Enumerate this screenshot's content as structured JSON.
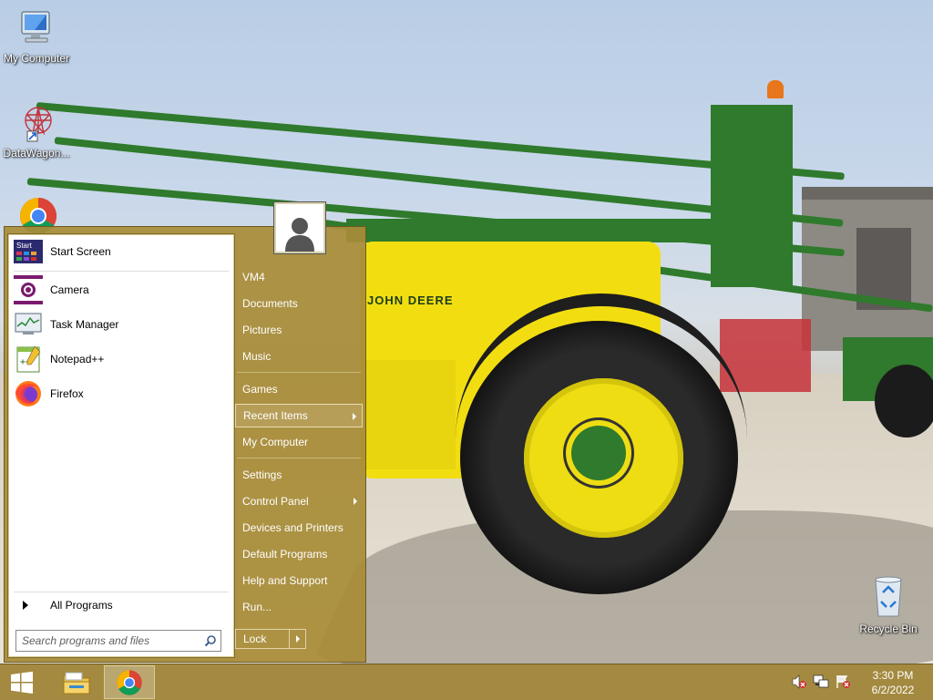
{
  "desktop": {
    "icons": [
      {
        "label": "My Computer"
      },
      {
        "label": "DataWagon..."
      },
      {
        "label": "Recycle Bin"
      }
    ],
    "wallpaper_brand": "JOHN DEERE"
  },
  "start_menu": {
    "programs": [
      {
        "label": "Start Screen",
        "icon": "start-screen-icon"
      },
      {
        "label": "Camera",
        "icon": "camera-icon"
      },
      {
        "label": "Task Manager",
        "icon": "task-manager-icon"
      },
      {
        "label": "Notepad++",
        "icon": "notepad-plus-plus-icon"
      },
      {
        "label": "Firefox",
        "icon": "firefox-icon"
      }
    ],
    "start_screen_tile_text": "Start",
    "all_programs": "All Programs",
    "search_placeholder": "Search programs and files",
    "right": {
      "user": "VM4",
      "documents": "Documents",
      "pictures": "Pictures",
      "music": "Music",
      "games": "Games",
      "recent_items": "Recent Items",
      "my_computer": "My Computer",
      "settings": "Settings",
      "control_panel": "Control Panel",
      "devices_printers": "Devices and Printers",
      "default_programs": "Default Programs",
      "help_support": "Help and Support",
      "run": "Run..."
    },
    "lock": "Lock"
  },
  "taskbar": {
    "pinned": [
      "file-explorer-icon",
      "chrome-icon"
    ],
    "tray_icons": [
      "volume-muted-icon",
      "network-icon",
      "action-center-icon"
    ],
    "time": "3:30 PM",
    "date": "6/2/2022"
  },
  "colors": {
    "start_menu_accent": "#a88c38",
    "taskbar": "#a0863a"
  }
}
